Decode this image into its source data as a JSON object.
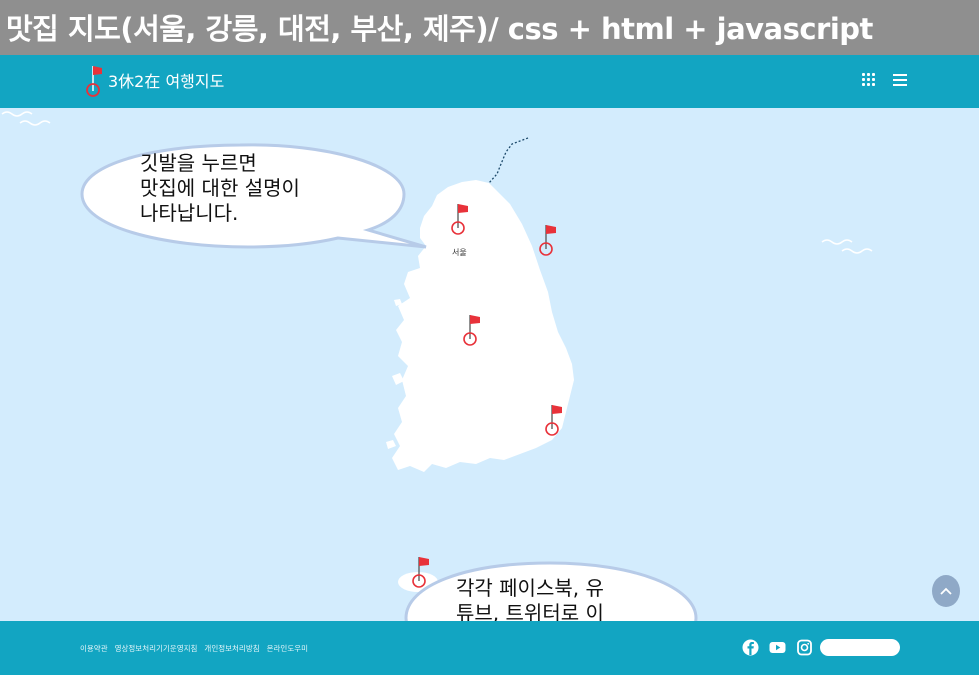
{
  "caption": {
    "title": "맛집 지도(서울, 강릉, 대전, 부산, 제주)/ css + html + javascript"
  },
  "header": {
    "logo_text": "3休2在 여행지도",
    "icons": [
      "flag-logo-icon",
      "grid-icon",
      "menu-icon"
    ]
  },
  "map": {
    "city_labels": {
      "seoul": "서울"
    },
    "pins": [
      "seoul",
      "gangneung",
      "daejeon",
      "busan",
      "jeju"
    ]
  },
  "callouts": {
    "top": "깃발을 누르면\n맛집에 대한 설명이\n나타납니다.",
    "bottom": "각각 페이스북, 유\n튜브, 트위터로 이\n동하는 버튼"
  },
  "footer": {
    "links": [
      "이용약관",
      "영상정보처리기기운영지침",
      "개인정보처리방침",
      "온라인도우미"
    ],
    "social_icons": [
      "facebook-icon",
      "youtube-icon",
      "instagram-icon"
    ]
  },
  "colors": {
    "nav": "#12a5c2",
    "sea": "#d3ecfd",
    "flag": "#e8323a",
    "title_bar": "#8f8f8f"
  }
}
